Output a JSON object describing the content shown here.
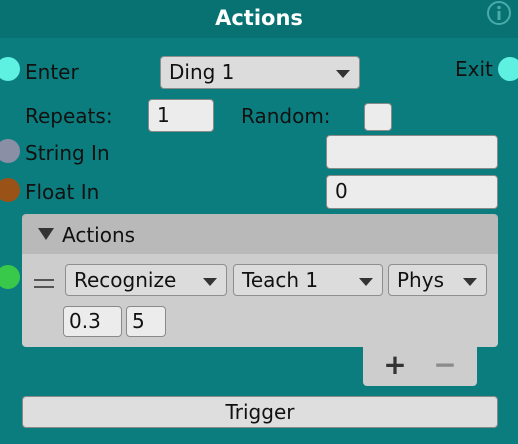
{
  "node": {
    "title": "Actions",
    "colors": {
      "background": "#0c7d7f",
      "title_bar": "#087272",
      "port_flow": "#5ef0e0",
      "port_string": "#8a8fa6",
      "port_float": "#9a5216",
      "port_action": "#38c94a"
    }
  },
  "enter": {
    "label": "Enter",
    "dropdown_value": "Ding 1"
  },
  "exit": {
    "label": "Exit"
  },
  "repeats": {
    "label": "Repeats:",
    "value": "1"
  },
  "random": {
    "label": "Random:",
    "checked": false
  },
  "string_in": {
    "label": "String In",
    "value": ""
  },
  "float_in": {
    "label": "Float In",
    "value": "0"
  },
  "actions_list": {
    "header_label": "Actions",
    "expanded": true,
    "items": [
      {
        "dropdown1": "Recognize",
        "dropdown2": "Teach 1",
        "dropdown3": "Phys",
        "value1": "0.3",
        "value2": "5"
      }
    ],
    "add_label": "+",
    "remove_label": "−"
  },
  "trigger": {
    "label": "Trigger"
  }
}
